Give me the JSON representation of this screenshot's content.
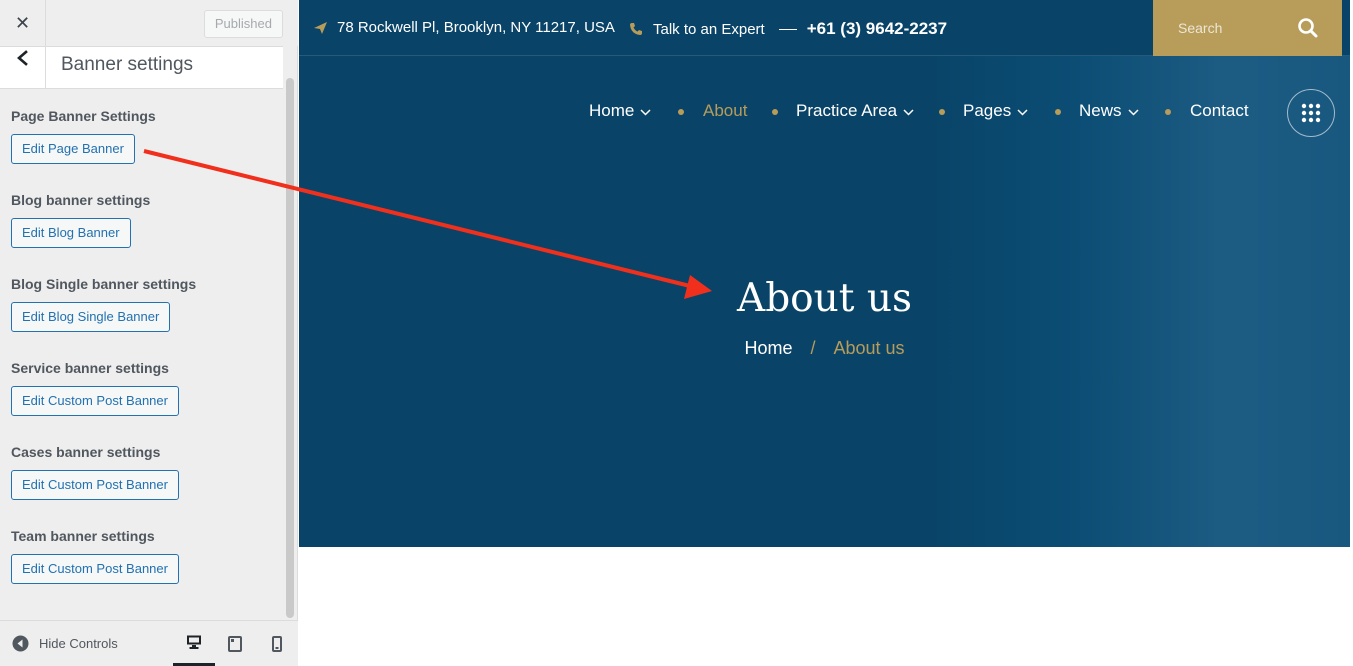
{
  "customizer": {
    "close_glyph": "✕",
    "published_label": "Published",
    "panel_title": "Banner settings",
    "groups": [
      {
        "title": "Page Banner Settings",
        "button": "Edit Page Banner"
      },
      {
        "title": "Blog banner settings",
        "button": "Edit Blog Banner"
      },
      {
        "title": "Blog Single banner settings",
        "button": "Edit Blog Single Banner"
      },
      {
        "title": "Service banner settings",
        "button": "Edit Custom Post Banner"
      },
      {
        "title": "Cases banner settings",
        "button": "Edit Custom Post Banner"
      },
      {
        "title": "Team banner settings",
        "button": "Edit Custom Post Banner"
      }
    ],
    "footer": {
      "hide_controls_label": "Hide Controls",
      "devices": [
        "desktop-icon",
        "tablet-icon",
        "mobile-icon"
      ],
      "active_device": "desktop"
    }
  },
  "site": {
    "topbar": {
      "address": "78 Rockwell Pl, Brooklyn, NY 11217, USA",
      "talk_label": "Talk to an Expert",
      "phone": "+61 (3) 9642-2237",
      "search_placeholder": "Search"
    },
    "nav": [
      {
        "label": "Home",
        "has_dropdown": true
      },
      {
        "label": "About",
        "has_dropdown": false,
        "active": true
      },
      {
        "label": "Practice Area",
        "has_dropdown": true
      },
      {
        "label": "Pages",
        "has_dropdown": true
      },
      {
        "label": "News",
        "has_dropdown": true
      },
      {
        "label": "Contact",
        "has_dropdown": false
      }
    ],
    "hero": {
      "title": "About us",
      "breadcrumb": {
        "home": "Home",
        "separator": "/",
        "current": "About us"
      }
    }
  },
  "colors": {
    "hero_bg": "#094468",
    "accent_gold": "#b79c5a",
    "annotation_arrow": "#f0301c",
    "wp_link_blue": "#2271b1"
  }
}
